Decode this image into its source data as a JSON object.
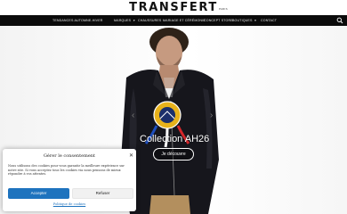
{
  "header": {
    "logo": "TRANSFERT",
    "logo_sub": "PARIS"
  },
  "nav": {
    "items": [
      {
        "label": "TENDANCES AUTOMNE-HIVER",
        "dropdown": false
      },
      {
        "label": "MARQUES",
        "dropdown": true
      },
      {
        "label": "CHAUSSURES",
        "dropdown": false
      },
      {
        "label": "MARIAGE ET CÉRÉMONIE",
        "dropdown": false
      },
      {
        "label": "CONCEPT STORE",
        "dropdown": false
      },
      {
        "label": "BOUTIQUES",
        "dropdown": true
      },
      {
        "label": "CONTACT",
        "dropdown": false
      }
    ],
    "search_icon": "search-icon"
  },
  "hero": {
    "title": "Collection AH26",
    "button_label": "Je découvre",
    "slides_count": 3,
    "active_slide": 1,
    "prev_icon": "chevron-left-icon",
    "next_icon": "chevron-right-icon",
    "patch_text": "PATROUILLE DE FRANCE"
  },
  "consent": {
    "title": "Gérer le consentement",
    "text": "Nous utilisons des cookies pour vous garantir la meilleure expérience sur notre site. Si vous acceptez tous les cookies via nous pensons de mieux répondre à vos attentes.",
    "accept_label": "Accepter",
    "refuse_label": "Refuser",
    "policy_link": "Politique de cookies",
    "close_icon": "close-icon"
  },
  "colors": {
    "accent": "#1e73be",
    "navbar": "#0b0b0b",
    "jacket": "#16161c"
  }
}
